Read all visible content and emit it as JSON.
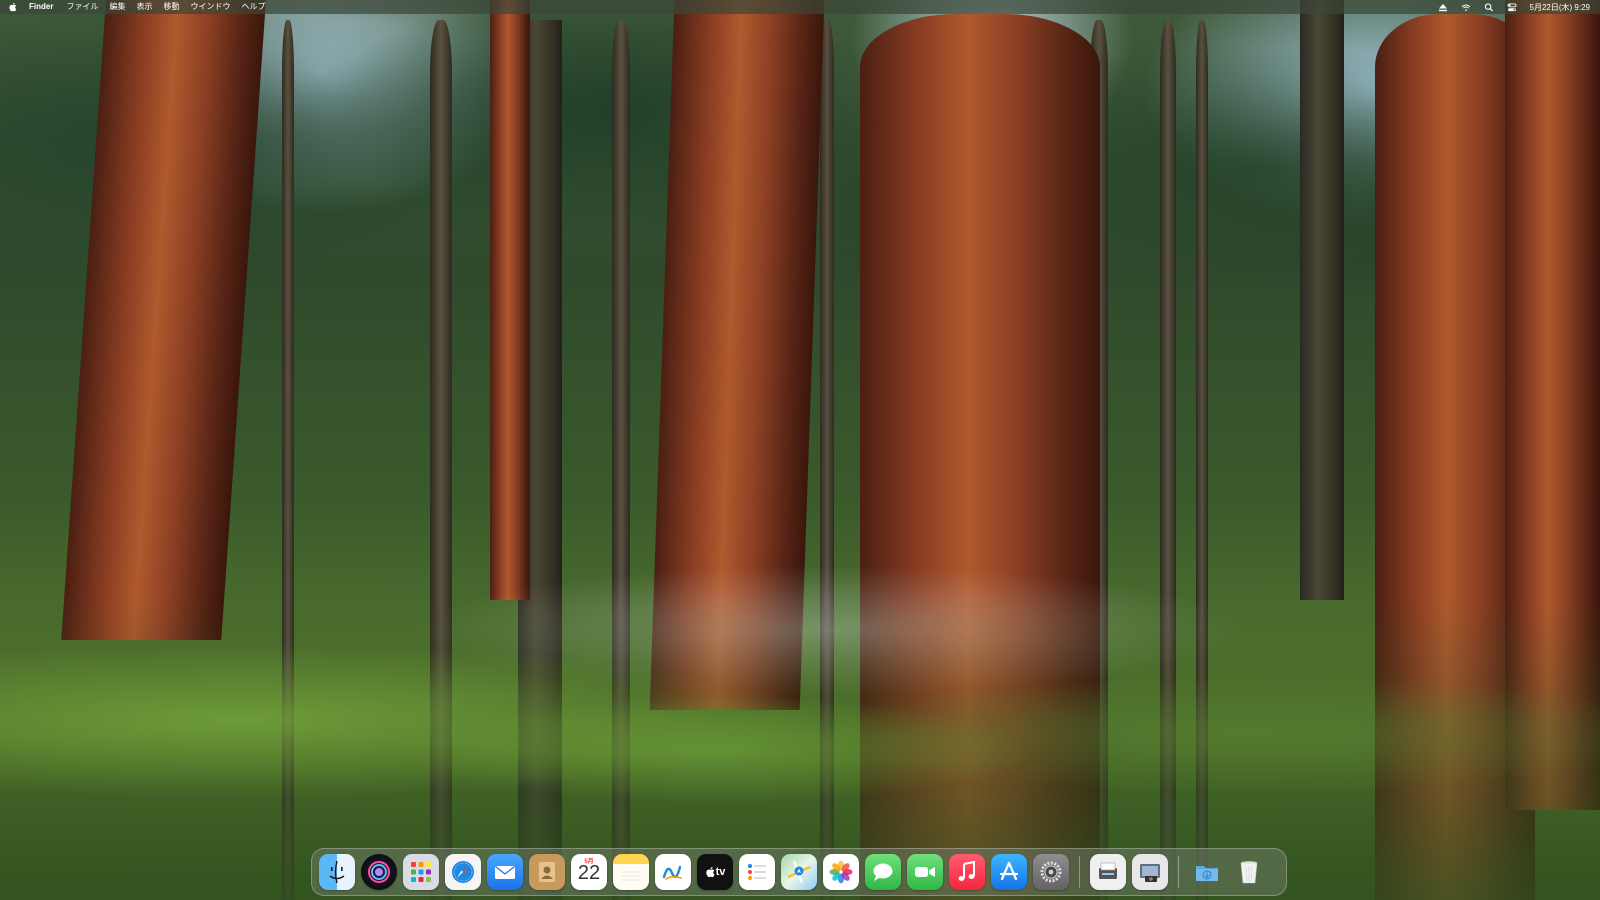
{
  "menubar": {
    "app_name": "Finder",
    "items": [
      "ファイル",
      "編集",
      "表示",
      "移動",
      "ウインドウ",
      "ヘルプ"
    ],
    "clock": "5月22日(木) 9:29",
    "status_icons": [
      "eject-icon",
      "wifi-icon",
      "spotlight-search-icon",
      "control-center-icon"
    ]
  },
  "dock": {
    "calendar": {
      "month": "5月",
      "day": "22"
    },
    "tv_label": "tv",
    "apps": [
      "finder",
      "siri",
      "launchpad",
      "safari",
      "mail",
      "contacts",
      "calendar",
      "notes",
      "freeform",
      "apple-tv",
      "reminders",
      "maps",
      "photos",
      "messages",
      "facetime",
      "music",
      "app-store",
      "system-settings",
      "preview",
      "screenshot",
      "downloads",
      "trash"
    ]
  },
  "colors": {
    "menubar_bg": "#3c4637",
    "dock_bg": "#78826f",
    "accent_red": "#e53935",
    "safari_blue": "#1e88e5"
  }
}
